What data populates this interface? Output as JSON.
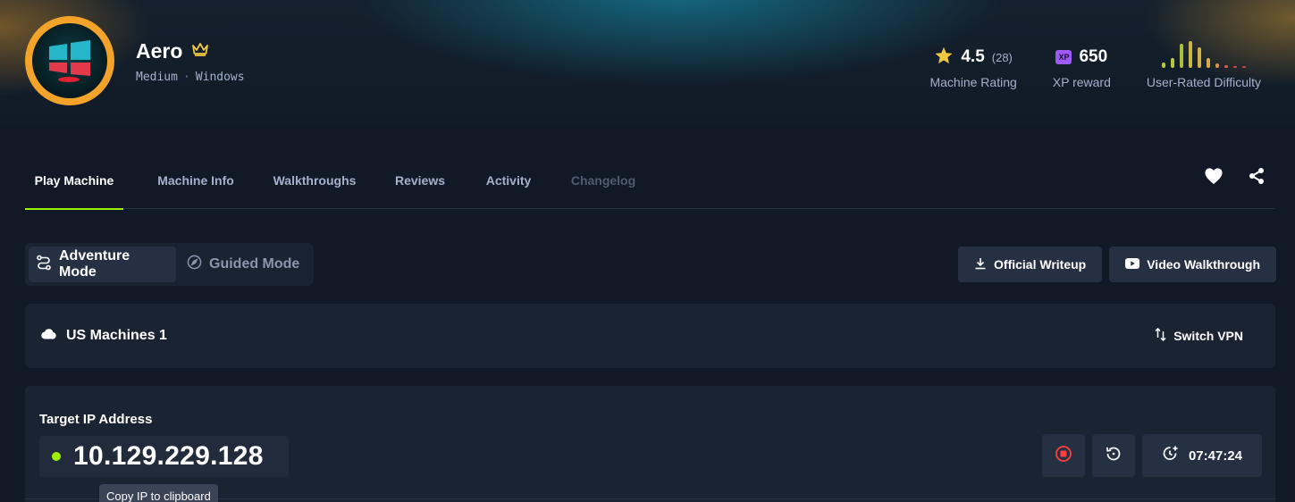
{
  "header": {
    "machine_name": "Aero",
    "difficulty": "Medium",
    "os": "Windows",
    "rating": "4.5",
    "rating_count": "(28)",
    "rating_label": "Machine Rating",
    "xp_badge": "XP",
    "xp_value": "650",
    "xp_label": "XP reward",
    "difficulty_label": "User-Rated Difficulty",
    "difficulty_bars": [
      0.2,
      0.35,
      0.9,
      1.0,
      0.75,
      0.35,
      0.15,
      0.1,
      0.08,
      0.06
    ],
    "difficulty_colors": [
      "#b7c83a",
      "#b7c83a",
      "#a9c03a",
      "#c9b844",
      "#d2b04a",
      "#d8a84c",
      "#d89448",
      "#d65f4a",
      "#d24c4a",
      "#cc4444"
    ]
  },
  "tabs": [
    {
      "label": "Play Machine",
      "state": "active"
    },
    {
      "label": "Machine Info",
      "state": "normal"
    },
    {
      "label": "Walkthroughs",
      "state": "normal"
    },
    {
      "label": "Reviews",
      "state": "normal"
    },
    {
      "label": "Activity",
      "state": "normal"
    },
    {
      "label": "Changelog",
      "state": "disabled"
    }
  ],
  "modes": {
    "adventure": "Adventure Mode",
    "guided": "Guided Mode"
  },
  "buttons": {
    "official_writeup": "Official Writeup",
    "video_walkthrough": "Video Walkthrough"
  },
  "vpn": {
    "server": "US Machines 1",
    "switch_label": "Switch VPN"
  },
  "target": {
    "label": "Target IP Address",
    "ip": "10.129.229.128",
    "timer": "07:47:24",
    "tooltip": "Copy IP to clipboard"
  },
  "colors": {
    "accent": "#9fef00",
    "background": "#111927",
    "card": "#1a2332",
    "xp_purple": "#9f5af5",
    "star": "#f2c744",
    "stop_red": "#ff3e3e"
  }
}
